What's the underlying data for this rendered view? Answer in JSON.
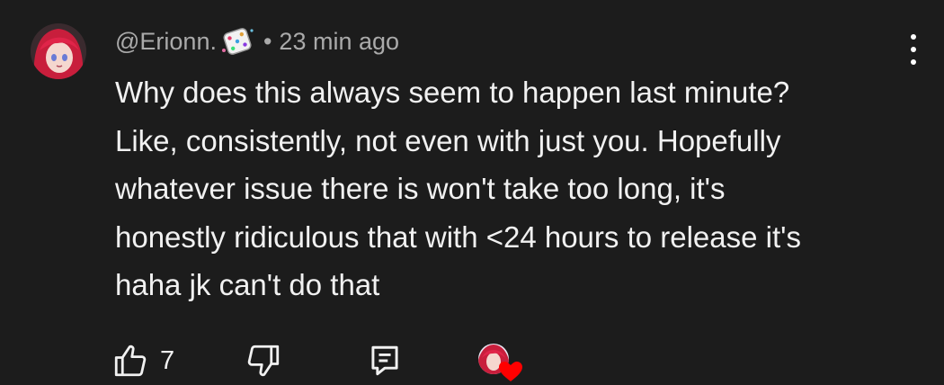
{
  "comment": {
    "author": "@Erionn.",
    "separator": "•",
    "timestamp": "23 min ago",
    "text_lines": [
      "Why does this always seem to happen last minute?",
      "Like, consistently, not even with just you. Hopefully",
      "whatever issue there is won't take too long, it's",
      "honestly ridiculous that with <24 hours to release it's",
      "haha jk can't do that"
    ],
    "like_count": "7"
  },
  "icons": {
    "avatar": "avatar-red-hair-character",
    "badge": "dice-badge-icon",
    "more": "more-vert-icon",
    "like": "thumbs-up-icon",
    "dislike": "thumbs-down-icon",
    "reply": "reply-icon",
    "creator_heart": "creator-heart-icon"
  },
  "colors": {
    "background": "#1c1c1c",
    "text": "#f1f1f1",
    "meta_text": "#aaaaaa",
    "heart": "#ff0000"
  }
}
